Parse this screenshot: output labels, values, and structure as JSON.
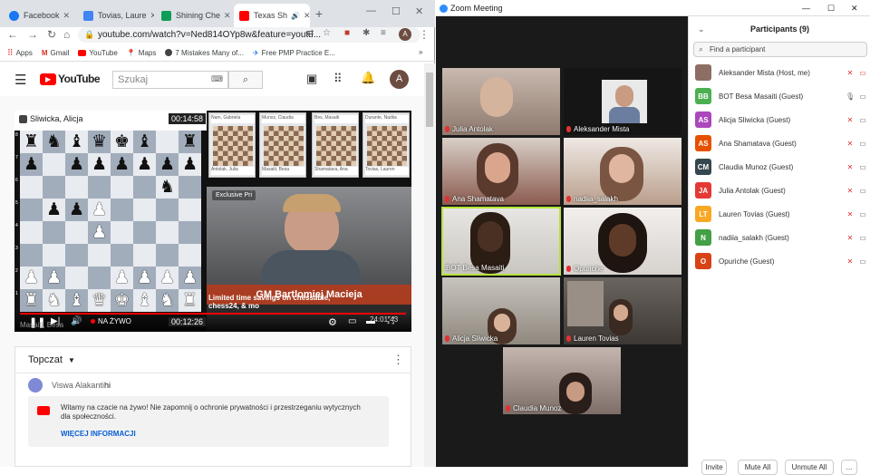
{
  "browser": {
    "tabs": [
      {
        "label": "Facebook",
        "color": "#1877f2"
      },
      {
        "label": "Tovias, Laure",
        "color": "#4285f4"
      },
      {
        "label": "Shining Che",
        "color": "#0f9d58"
      },
      {
        "label": "Texas Sh",
        "color": "#ff0000"
      }
    ],
    "new_tab": "+",
    "url": "youtube.com/watch?v=Ned814OYp8w&feature=youtu...",
    "profile_initial": "A",
    "bookmarks": [
      "Apps",
      "Gmail",
      "YouTube",
      "Maps",
      "7 Mistakes Many of...",
      "Free PMP Practice E..."
    ],
    "bookmarks_more": "»"
  },
  "youtube": {
    "logo": "YouTube",
    "search_placeholder": "Szukaj",
    "avatar_initial": "A",
    "player": {
      "top_name": "Sliwicka, Alicja",
      "top_time": "00:14:58",
      "bottom_time": "00:12:26",
      "bottom_name": "Masaiti, Besa",
      "live_label": "NA ŻYWO",
      "time_right": "24:01:43",
      "streamer_title": "GM Bartlomiej Macieja",
      "promo_text": "Limited time savings on chessable, chess24, & mo",
      "promo_badge": "Exclusive Pri",
      "rank_files": [
        "a",
        "b",
        "c",
        "d",
        "e",
        "f",
        "g",
        "h"
      ],
      "ranks": [
        "8",
        "7",
        "6",
        "5",
        "4",
        "3",
        "2",
        "1"
      ],
      "board_rows": [
        "r n b q k b . r",
        "p . p p p p p p",
        ". . . . . . n .",
        ". p p P . . . .",
        ". . . P . . . .",
        ". . . . . . . .",
        "P P . . P P P P",
        "R N B Q K B N R"
      ],
      "mini_boards": [
        {
          "top": "Nam, Gabriela",
          "bottom": "Antolak, Julia"
        },
        {
          "top": "Munoz, Claudia",
          "bottom": "Masaiti, Besa"
        },
        {
          "top": "Bes, Masaiti",
          "bottom": "Shamatava, Ana"
        },
        {
          "top": "Durante, Nadiia",
          "bottom": "Tovias, Lauren"
        }
      ]
    },
    "chat": {
      "header": "Topczat",
      "user": "Viswa Alakanti",
      "message": "hi",
      "notice": "Witamy na czacie na żywo! Nie zapomnij o ochronie prywatności i przestrzeganiu wytycznych dla społeczności.",
      "more_link": "WIĘCEJ INFORMACJI"
    }
  },
  "zoom": {
    "title": "Zoom Meeting",
    "tiles": [
      {
        "name": "Julia Antolak"
      },
      {
        "name": "Aleksander Mista"
      },
      {
        "name": "Ana Shamatava"
      },
      {
        "name": "nadiia_salakh"
      },
      {
        "name": "BOT Besa Masaiti"
      },
      {
        "name": "Opuriche"
      },
      {
        "name": "Alicja Sliwicka"
      },
      {
        "name": "Lauren Tovias"
      },
      {
        "name": "Claudia Munoz"
      }
    ],
    "panel_title": "Participants (9)",
    "search_placeholder": "Find a participant",
    "participants": [
      {
        "initials": "",
        "name": "Aleksander Mista (Host, me)",
        "color": "#8d6e63"
      },
      {
        "initials": "BB",
        "name": "BOT Besa Masaiti (Guest)",
        "color": "#4caf50"
      },
      {
        "initials": "AS",
        "name": "Alicja Sliwicka (Guest)",
        "color": "#ab47bc"
      },
      {
        "initials": "AS",
        "name": "Ana Shamatava (Guest)",
        "color": "#e65100"
      },
      {
        "initials": "CM",
        "name": "Claudia Munoz (Guest)",
        "color": "#37474f"
      },
      {
        "initials": "JA",
        "name": "Julia Antolak (Guest)",
        "color": "#e53935"
      },
      {
        "initials": "LT",
        "name": "Lauren Tovias (Guest)",
        "color": "#f9a825"
      },
      {
        "initials": "N",
        "name": "nadiia_salakh (Guest)",
        "color": "#43a047"
      },
      {
        "initials": "O",
        "name": "Opuriche (Guest)",
        "color": "#d84315"
      }
    ],
    "buttons": {
      "invite": "Invite",
      "mute_all": "Mute All",
      "unmute_all": "Unmute All",
      "more": "..."
    }
  }
}
